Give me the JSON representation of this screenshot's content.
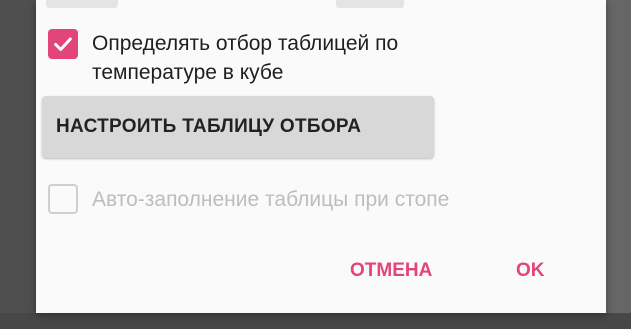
{
  "dialog": {
    "checkbox_temp": {
      "checked": true,
      "label": "Определять отбор таблицей по температуре в кубе"
    },
    "config_button_label": "НАСТРОИТЬ ТАБЛИЦУ ОТБОРА",
    "checkbox_autofill": {
      "checked": false,
      "enabled": false,
      "label": "Авто-заполнение таблицы при стопе"
    },
    "actions": {
      "cancel_label": "ОТМЕНА",
      "ok_label": "OK"
    }
  },
  "colors": {
    "accent": "#e2457a",
    "dialog_bg": "#fafafa",
    "button_bg": "#d8d8d8",
    "disabled_text": "#bdbdbd",
    "backdrop": "#5b5b5b"
  },
  "icons": {
    "checked": "check-icon"
  }
}
